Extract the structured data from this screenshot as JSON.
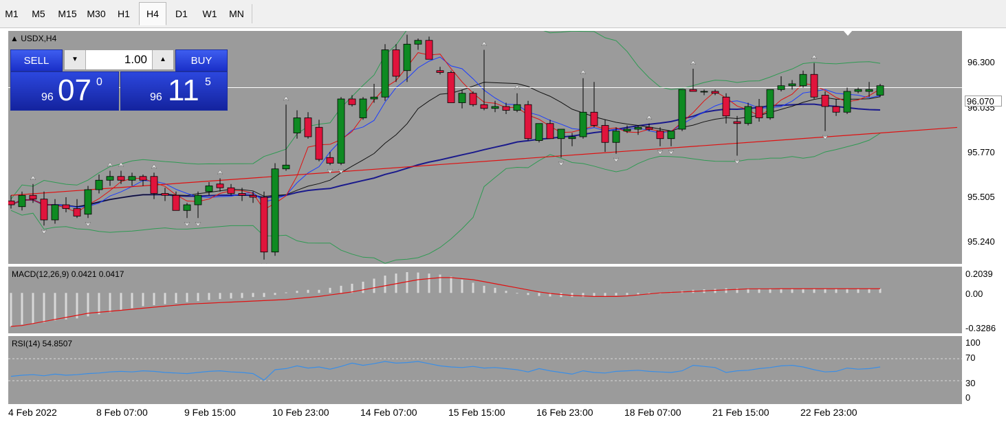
{
  "timeframes": [
    "M1",
    "M5",
    "M15",
    "M30",
    "H1",
    "H4",
    "D1",
    "W1",
    "MN"
  ],
  "active_timeframe": "H4",
  "symbol_label": "USDX,H4",
  "trade_panel": {
    "sell_label": "SELL",
    "buy_label": "BUY",
    "lot_value": "1.00",
    "sell_price_prefix": "96",
    "sell_price_big": "07",
    "sell_price_sup": "0",
    "buy_price_prefix": "96",
    "buy_price_big": "11",
    "buy_price_sup": "5"
  },
  "current_price_label": "96.070",
  "price_axis": [
    "96.300",
    "96.035",
    "95.770",
    "95.505",
    "95.240"
  ],
  "macd": {
    "title": "MACD(12,26,9) 0.0421 0.0417",
    "axis": [
      "0.2039",
      "0.00",
      "-0.3286"
    ]
  },
  "rsi": {
    "title": "RSI(14) 54.8507",
    "axis": [
      "100",
      "70",
      "30",
      "0"
    ]
  },
  "time_axis": [
    "4 Feb 2022",
    "8 Feb 07:00",
    "9 Feb 15:00",
    "10 Feb 23:00",
    "14 Feb 07:00",
    "15 Feb 15:00",
    "16 Feb 23:00",
    "18 Feb 07:00",
    "21 Feb 15:00",
    "22 Feb 23:00"
  ],
  "colors": {
    "chart_bg": "#9b9b9b",
    "bull_candle": "#0e8a22",
    "bear_candle": "#e0143c",
    "trendline": "#e01010",
    "ma_slow": "#1a1a8c",
    "ma_fast_red": "#e01010",
    "ma_fast_blue": "#1a3cff",
    "bollinger": "#2e9a52",
    "macd_signal": "#e01010",
    "rsi_line": "#3a8ee6",
    "trade_panel": "#2038d0"
  },
  "chart_data": {
    "type": "candlestick",
    "symbol": "USDX",
    "timeframe": "H4",
    "ylim": [
      95.13,
      96.37
    ],
    "candles": [
      [
        95.47,
        95.5,
        95.43,
        95.45
      ],
      [
        95.44,
        95.52,
        95.42,
        95.5
      ],
      [
        95.5,
        95.56,
        95.46,
        95.48
      ],
      [
        95.48,
        95.52,
        95.34,
        95.37
      ],
      [
        95.37,
        95.48,
        95.35,
        95.45
      ],
      [
        95.45,
        95.49,
        95.41,
        95.43
      ],
      [
        95.43,
        95.48,
        95.38,
        95.39
      ],
      [
        95.4,
        95.55,
        95.38,
        95.53
      ],
      [
        95.53,
        95.61,
        95.51,
        95.58
      ],
      [
        95.58,
        95.63,
        95.55,
        95.6
      ],
      [
        95.6,
        95.63,
        95.56,
        95.58
      ],
      [
        95.58,
        95.62,
        95.55,
        95.6
      ],
      [
        95.6,
        95.61,
        95.55,
        95.58
      ],
      [
        95.6,
        95.62,
        95.48,
        95.51
      ],
      [
        95.51,
        95.54,
        95.47,
        95.5
      ],
      [
        95.5,
        95.52,
        95.43,
        95.42
      ],
      [
        95.42,
        95.46,
        95.38,
        95.45
      ],
      [
        95.45,
        95.52,
        95.38,
        95.5
      ],
      [
        95.52,
        95.57,
        95.5,
        95.55
      ],
      [
        95.56,
        95.59,
        95.52,
        95.54
      ],
      [
        95.54,
        95.56,
        95.5,
        95.51
      ],
      [
        95.51,
        95.54,
        95.47,
        95.5
      ],
      [
        95.5,
        95.52,
        95.46,
        95.49
      ],
      [
        95.49,
        95.52,
        95.16,
        95.2
      ],
      [
        95.2,
        95.67,
        95.18,
        95.64
      ],
      [
        95.64,
        95.98,
        95.63,
        95.66
      ],
      [
        95.83,
        95.95,
        95.8,
        95.91
      ],
      [
        95.91,
        95.94,
        95.8,
        95.81
      ],
      [
        95.86,
        95.9,
        95.68,
        95.69
      ],
      [
        95.7,
        95.73,
        95.66,
        95.67
      ],
      [
        95.67,
        96.02,
        95.66,
        96.01
      ],
      [
        96.01,
        96.03,
        95.97,
        95.98
      ],
      [
        95.91,
        96.02,
        95.9,
        96.01
      ],
      [
        96.01,
        96.09,
        95.99,
        96.02
      ],
      [
        96.02,
        96.3,
        96.0,
        96.27
      ],
      [
        96.27,
        96.3,
        96.1,
        96.13
      ],
      [
        96.16,
        96.35,
        96.1,
        96.3
      ],
      [
        96.3,
        96.33,
        96.27,
        96.32
      ],
      [
        96.32,
        96.34,
        96.22,
        96.22
      ],
      [
        96.16,
        96.18,
        96.14,
        96.15
      ],
      [
        96.15,
        96.16,
        95.99,
        95.99
      ],
      [
        95.99,
        96.06,
        95.96,
        96.04
      ],
      [
        96.04,
        96.05,
        95.97,
        95.98
      ],
      [
        95.98,
        96.27,
        95.95,
        95.96
      ],
      [
        95.96,
        96.0,
        95.94,
        95.97
      ],
      [
        95.97,
        95.99,
        95.93,
        95.95
      ],
      [
        95.95,
        96.04,
        95.94,
        95.98
      ],
      [
        95.98,
        96.0,
        95.79,
        95.8
      ],
      [
        95.79,
        95.88,
        95.78,
        95.88
      ],
      [
        95.88,
        95.9,
        95.8,
        95.8
      ],
      [
        95.8,
        95.85,
        95.7,
        95.85
      ],
      [
        95.8,
        95.83,
        95.76,
        95.81
      ],
      [
        95.81,
        96.12,
        95.8,
        95.94
      ],
      [
        95.94,
        96.1,
        95.86,
        95.87
      ],
      [
        95.87,
        95.9,
        95.73,
        95.78
      ],
      [
        95.78,
        95.86,
        95.72,
        95.84
      ],
      [
        95.84,
        95.87,
        95.83,
        95.85
      ],
      [
        95.85,
        95.87,
        95.82,
        95.86
      ],
      [
        95.86,
        95.88,
        95.84,
        95.85
      ],
      [
        95.84,
        95.86,
        95.76,
        95.8
      ],
      [
        95.8,
        95.84,
        95.76,
        95.84
      ],
      [
        95.85,
        96.06,
        95.84,
        96.06
      ],
      [
        96.06,
        96.17,
        96.05,
        96.05
      ],
      [
        96.05,
        96.06,
        96.03,
        96.05
      ],
      [
        96.05,
        96.06,
        96.03,
        96.04
      ],
      [
        96.02,
        96.04,
        95.88,
        95.92
      ],
      [
        95.89,
        95.92,
        95.71,
        95.88
      ],
      [
        95.88,
        95.99,
        95.87,
        95.97
      ],
      [
        95.97,
        96.01,
        95.89,
        95.91
      ],
      [
        95.91,
        96.03,
        95.9,
        96.06
      ],
      [
        96.06,
        96.13,
        96.05,
        96.08
      ],
      [
        96.08,
        96.11,
        96.06,
        96.09
      ],
      [
        96.08,
        96.16,
        96.07,
        96.14
      ],
      [
        96.14,
        96.2,
        96.01,
        96.02
      ],
      [
        96.03,
        96.05,
        95.84,
        95.97
      ],
      [
        95.97,
        96.01,
        95.92,
        95.94
      ],
      [
        95.94,
        96.07,
        95.93,
        96.05
      ],
      [
        96.05,
        96.07,
        96.04,
        96.06
      ],
      [
        96.05,
        96.1,
        96.02,
        96.06
      ],
      [
        96.03,
        96.09,
        96.02,
        96.08
      ]
    ],
    "trendline": [
      [
        0,
        95.5
      ],
      [
        79,
        95.83
      ]
    ],
    "rsi_values": [
      38,
      40,
      41,
      39,
      42,
      40,
      41,
      43,
      44,
      46,
      47,
      46,
      48,
      47,
      45,
      44,
      43,
      45,
      47,
      48,
      46,
      45,
      43,
      31,
      50,
      52,
      57,
      53,
      55,
      51,
      56,
      62,
      58,
      61,
      65,
      62,
      63,
      65,
      61,
      57,
      55,
      54,
      56,
      53,
      54,
      52,
      50,
      46,
      52,
      48,
      45,
      42,
      48,
      45,
      44,
      47,
      48,
      49,
      47,
      46,
      45,
      48,
      58,
      56,
      54,
      45,
      48,
      49,
      52,
      54,
      57,
      58,
      55,
      50,
      46,
      47,
      53,
      51,
      52,
      55
    ],
    "macd_hist": [
      -0.3286,
      -0.31,
      -0.3,
      -0.29,
      -0.27,
      -0.26,
      -0.25,
      -0.23,
      -0.21,
      -0.19,
      -0.17,
      -0.15,
      -0.13,
      -0.12,
      -0.11,
      -0.1,
      -0.09,
      -0.08,
      -0.07,
      -0.06,
      -0.055,
      -0.05,
      -0.04,
      -0.04,
      -0.02,
      0.005,
      0.02,
      0.03,
      0.03,
      0.05,
      0.07,
      0.09,
      0.11,
      0.14,
      0.17,
      0.19,
      0.2039,
      0.2,
      0.19,
      0.18,
      0.16,
      0.13,
      0.1,
      0.07,
      0.05,
      0.02,
      0.0,
      -0.02,
      -0.03,
      -0.035,
      -0.04,
      -0.04,
      -0.04,
      -0.035,
      -0.03,
      -0.025,
      -0.02,
      -0.015,
      -0.01,
      0.0,
      0.01,
      0.02,
      0.03,
      0.035,
      0.04,
      0.045,
      0.045,
      0.045,
      0.042,
      0.042,
      0.0421,
      0.0421,
      0.0421,
      0.0421,
      0.0421,
      0.0421,
      0.0421,
      0.0421,
      0.0421,
      0.0421
    ],
    "macd_signal": [
      -0.3286,
      -0.32,
      -0.3,
      -0.28,
      -0.26,
      -0.24,
      -0.22,
      -0.2,
      -0.19,
      -0.18,
      -0.17,
      -0.16,
      -0.15,
      -0.14,
      -0.13,
      -0.12,
      -0.11,
      -0.105,
      -0.1,
      -0.095,
      -0.09,
      -0.085,
      -0.08,
      -0.075,
      -0.07,
      -0.065,
      -0.055,
      -0.045,
      -0.035,
      -0.02,
      -0.005,
      0.01,
      0.03,
      0.05,
      0.07,
      0.09,
      0.11,
      0.13,
      0.14,
      0.15,
      0.15,
      0.14,
      0.13,
      0.11,
      0.09,
      0.07,
      0.05,
      0.03,
      0.01,
      -0.005,
      -0.015,
      -0.025,
      -0.03,
      -0.035,
      -0.035,
      -0.035,
      -0.03,
      -0.02,
      -0.01,
      0.0,
      0.005,
      0.01,
      0.015,
      0.02,
      0.025,
      0.03,
      0.035,
      0.04,
      0.04,
      0.04,
      0.0417,
      0.0417,
      0.0417,
      0.0417,
      0.0417,
      0.0417,
      0.0417,
      0.0417,
      0.0417,
      0.0417
    ]
  }
}
